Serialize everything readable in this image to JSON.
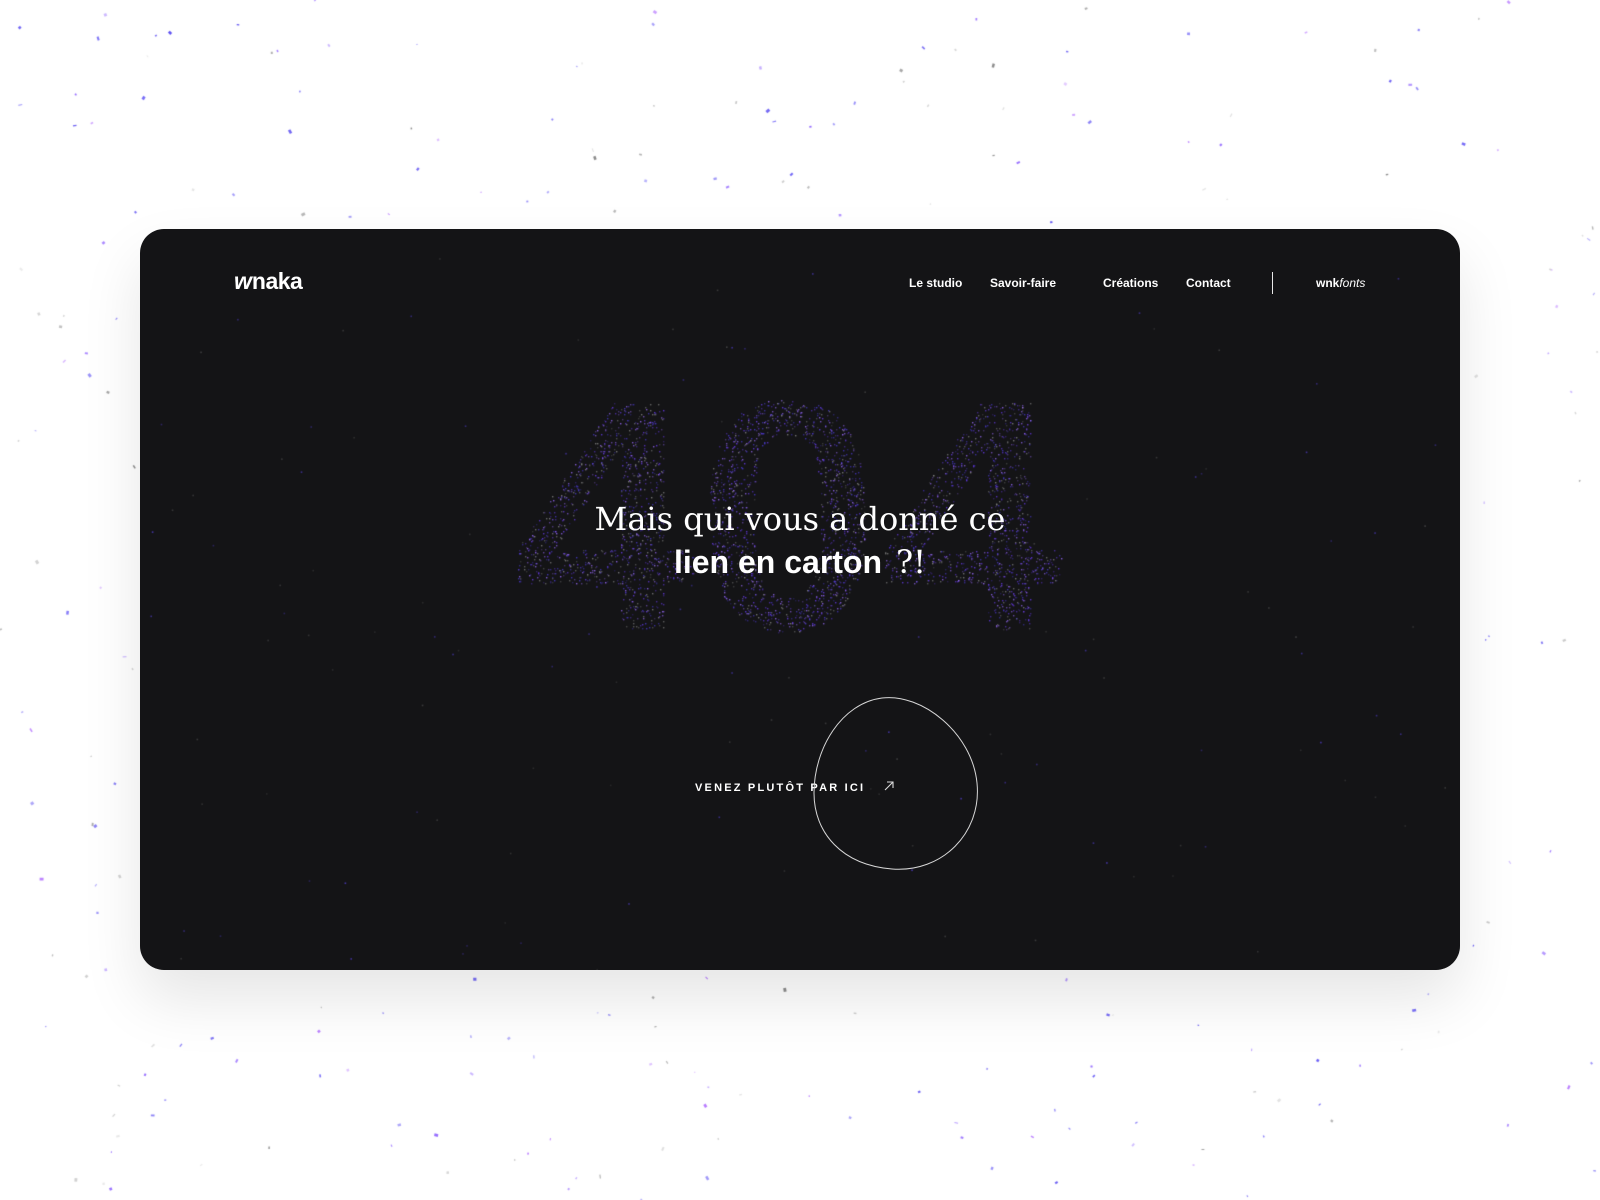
{
  "logo": {
    "mark": "w",
    "text": "naka"
  },
  "nav": {
    "items": [
      {
        "label": "Le studio"
      },
      {
        "label": "Savoir-faire"
      },
      {
        "label": "Créations"
      },
      {
        "label": "Contact"
      }
    ],
    "fonts_link": {
      "bold": "wnk",
      "italic": "fonts"
    }
  },
  "hero": {
    "background_number": "404",
    "headline_line1": "Mais qui vous a donné ce",
    "headline_bold": "lien en carton",
    "headline_punct": "?!",
    "cta_label": "VENEZ PLUTÔT PAR ICI",
    "cta_icon": "arrow-up-right-icon"
  },
  "colors": {
    "window_bg": "#141416",
    "page_bg": "#ffffff",
    "text": "#ffffff",
    "particle_primary": "#6a3cf0",
    "particle_secondary": "#9b6cff",
    "particle_gray": "#8a8a8a"
  }
}
